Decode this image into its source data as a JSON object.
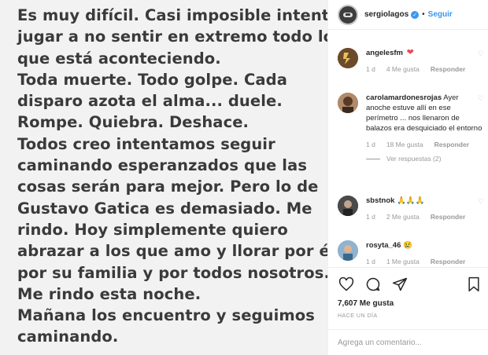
{
  "post": {
    "lines": [
      "Es muy difícil. Casi imposible intentar",
      "jugar a no sentir en extremo todo lo",
      "que está aconteciendo.",
      "Toda muerte. Todo golpe. Cada",
      "disparo azota el alma... duele.",
      "Rompe. Quiebra.  Deshace.",
      "Todos creo intentamos seguir",
      "caminando esperanzados que las",
      "cosas serán para mejor.  Pero lo de",
      "Gustavo Gatica es demasiado. Me",
      "rindo.  Hoy simplemente quiero",
      "abrazar a los que amo y llorar por él,",
      "por su familia y por todos nosotros.",
      "Me rindo esta noche.",
      "Mañana los encuentro y seguimos",
      "caminando."
    ]
  },
  "header": {
    "username": "sergiolagos",
    "separator": "•",
    "follow_label": "Seguir"
  },
  "comments": [
    {
      "username": "angelesfm",
      "text": "",
      "time": "1 d",
      "likes": "4 Me gusta",
      "reply": "Responder"
    },
    {
      "username": "carolamardonesrojas",
      "text": "Ayer anoche estuve allí en ese perímetro ... nos llenaron de balazos era desquiciado el entorno",
      "time": "1 d",
      "likes": "18 Me gusta",
      "reply": "Responder",
      "view_replies": "Ver respuestas (2)"
    },
    {
      "username": "sbstnok",
      "text": "🙏🙏🙏",
      "time": "1 d",
      "likes": "2 Me gusta",
      "reply": "Responder"
    },
    {
      "username": "rosyta_46",
      "text": "😢",
      "time": "1 d",
      "likes": "1 Me gusta",
      "reply": "Responder"
    }
  ],
  "actions": {
    "likes": "7,607 Me gusta",
    "time": "HACE UN DÍA",
    "add_comment_placeholder": "Agrega un comentario..."
  },
  "icons": [
    "heart-icon",
    "comment-icon",
    "share-icon",
    "bookmark-icon",
    "verified-icon"
  ],
  "colors": {
    "accent": "#3897f0",
    "heart": "#ed4956",
    "muted": "#999999",
    "post_text": "#3a3a3a",
    "post_bg": "#f2f2f2"
  }
}
